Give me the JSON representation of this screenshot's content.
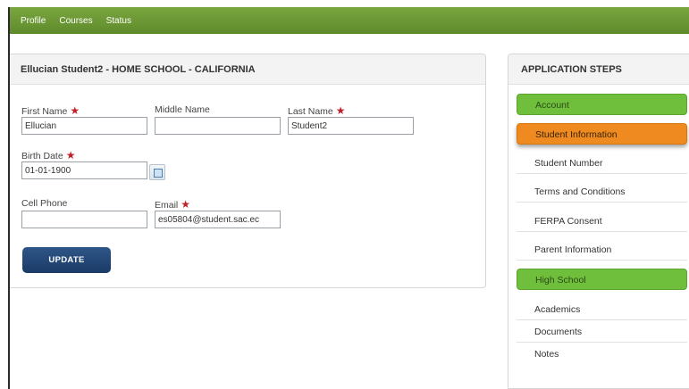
{
  "nav": {
    "items": [
      "Profile",
      "Courses",
      "Status"
    ]
  },
  "form": {
    "title": "Ellucian Student2 - HOME SCHOOL - CALIFORNIA",
    "first_name": {
      "label": "First Name",
      "value": "Ellucian"
    },
    "middle_name": {
      "label": "Middle Name",
      "value": ""
    },
    "last_name": {
      "label": "Last Name",
      "value": "Student2"
    },
    "birth_date": {
      "label": "Birth Date",
      "value": "01-01-1900"
    },
    "cell_phone": {
      "label": "Cell Phone",
      "value": ""
    },
    "email": {
      "label": "Email",
      "value": "es05804@student.sac.ec"
    },
    "required_mark": "★",
    "update_label": "UPDATE"
  },
  "steps": {
    "title": "APPLICATION STEPS",
    "items": [
      {
        "label": "Account",
        "state": "green"
      },
      {
        "label": "Student Information",
        "state": "orange"
      },
      {
        "label": "Student Number",
        "state": "plain"
      },
      {
        "label": "Terms and Conditions",
        "state": "plain"
      },
      {
        "label": "FERPA Consent",
        "state": "plain"
      },
      {
        "label": "Parent Information",
        "state": "plain"
      },
      {
        "label": "High School",
        "state": "green"
      }
    ],
    "subitems": [
      "Academics",
      "Documents",
      "Notes"
    ]
  },
  "colors": {
    "nav_green": "#6a9635",
    "step_green": "#6fbf3c",
    "step_orange": "#ee8a1f",
    "button_blue": "#24487a",
    "required_red": "#c0202a"
  }
}
